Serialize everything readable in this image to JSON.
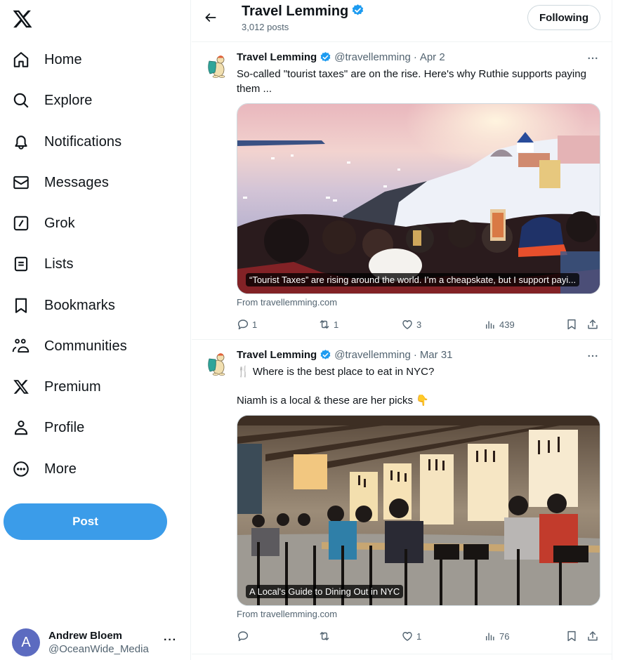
{
  "sidebar": {
    "logo": "X",
    "items": [
      {
        "label": "Home",
        "icon": "home-icon"
      },
      {
        "label": "Explore",
        "icon": "search-icon"
      },
      {
        "label": "Notifications",
        "icon": "bell-icon"
      },
      {
        "label": "Messages",
        "icon": "envelope-icon"
      },
      {
        "label": "Grok",
        "icon": "grok-icon"
      },
      {
        "label": "Lists",
        "icon": "list-icon"
      },
      {
        "label": "Bookmarks",
        "icon": "bookmark-icon"
      },
      {
        "label": "Communities",
        "icon": "communities-icon"
      },
      {
        "label": "Premium",
        "icon": "x-logo-icon"
      },
      {
        "label": "Profile",
        "icon": "person-icon"
      },
      {
        "label": "More",
        "icon": "more-circle-icon"
      }
    ],
    "post_label": "Post",
    "account": {
      "avatar_letter": "A",
      "name": "Andrew Bloem",
      "handle": "@OceanWide_Media",
      "more": "···"
    }
  },
  "header": {
    "title": "Travel Lemming",
    "post_count": "3,012 posts",
    "follow_label": "Following"
  },
  "tweets": [
    {
      "name": "Travel Lemming",
      "handle": "@travellemming",
      "dot": "·",
      "date": "Apr 2",
      "text_lines": [
        "So-called \"tourist taxes\" are on the rise. Here's why Ruthie supports paying them ..."
      ],
      "card_caption": "“Tourist Taxes” are rising around the world. I’m a cheapskate, but I support payi...",
      "card_source": "From travellemming.com",
      "stats": {
        "replies": "1",
        "reposts": "1",
        "likes": "3",
        "views": "439"
      }
    },
    {
      "name": "Travel Lemming",
      "handle": "@travellemming",
      "dot": "·",
      "date": "Mar 31",
      "text_lines": [
        "🍴 Where is the best place to eat in NYC?",
        "Niamh is a local & these are her picks 👇"
      ],
      "card_caption": "A Local's Guide to Dining Out in NYC",
      "card_source": "From travellemming.com",
      "stats": {
        "replies": "",
        "reposts": "",
        "likes": "1",
        "views": "76"
      }
    }
  ],
  "colors": {
    "accent": "#1d9bf0",
    "post_button": "#3b9ce9",
    "text_primary": "#0f1419",
    "text_secondary": "#536471",
    "border": "#eff3f4"
  }
}
